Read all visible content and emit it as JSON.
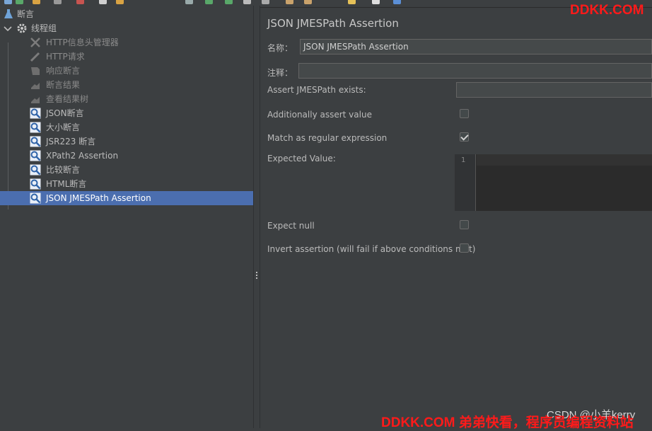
{
  "tree": {
    "root": "断言",
    "group": "线程组",
    "items": [
      {
        "label": "HTTP信息头管理器",
        "icon": "wrench-icon",
        "enabled": false
      },
      {
        "label": "HTTP请求",
        "icon": "pencil-icon",
        "enabled": false
      },
      {
        "label": "响应断言",
        "icon": "assertion-icon",
        "enabled": false
      },
      {
        "label": "断言结果",
        "icon": "chart-icon",
        "enabled": false
      },
      {
        "label": "查看结果树",
        "icon": "chart-icon",
        "enabled": false
      },
      {
        "label": "JSON断言",
        "icon": "magnifier-icon",
        "enabled": true
      },
      {
        "label": "大小断言",
        "icon": "magnifier-icon",
        "enabled": true
      },
      {
        "label": "JSR223 断言",
        "icon": "magnifier-icon",
        "enabled": true
      },
      {
        "label": "XPath2 Assertion",
        "icon": "magnifier-icon",
        "enabled": true
      },
      {
        "label": "比较断言",
        "icon": "magnifier-icon",
        "enabled": true
      },
      {
        "label": "HTML断言",
        "icon": "magnifier-icon",
        "enabled": true
      },
      {
        "label": "JSON JMESPath Assertion",
        "icon": "magnifier-icon",
        "enabled": true,
        "selected": true
      }
    ]
  },
  "form": {
    "title": "JSON JMESPath Assertion",
    "name_label": "名称：",
    "name_value": "JSON JMESPath Assertion",
    "comment_label": "注释：",
    "comment_value": "",
    "exists_label": "Assert JMESPath exists:",
    "exists_value": "",
    "additionally_label": "Additionally assert value",
    "additionally_checked": false,
    "regex_label": "Match as regular expression",
    "regex_checked": true,
    "expected_label": "Expected Value:",
    "line_number": "1",
    "expect_null_label": "Expect null",
    "expect_null_checked": false,
    "invert_label": "Invert assertion (will fail if above conditions met)",
    "invert_checked": false
  },
  "watermarks": {
    "top_right": "DDKK.COM",
    "bottom": "DDKK.COM 弟弟快看，程序员编程资料站",
    "csdn": "CSDN @小羊kerry"
  },
  "colors": {
    "selection": "#4b6eaf",
    "background": "#3c3f41",
    "watermark": "#ff1a1a"
  }
}
